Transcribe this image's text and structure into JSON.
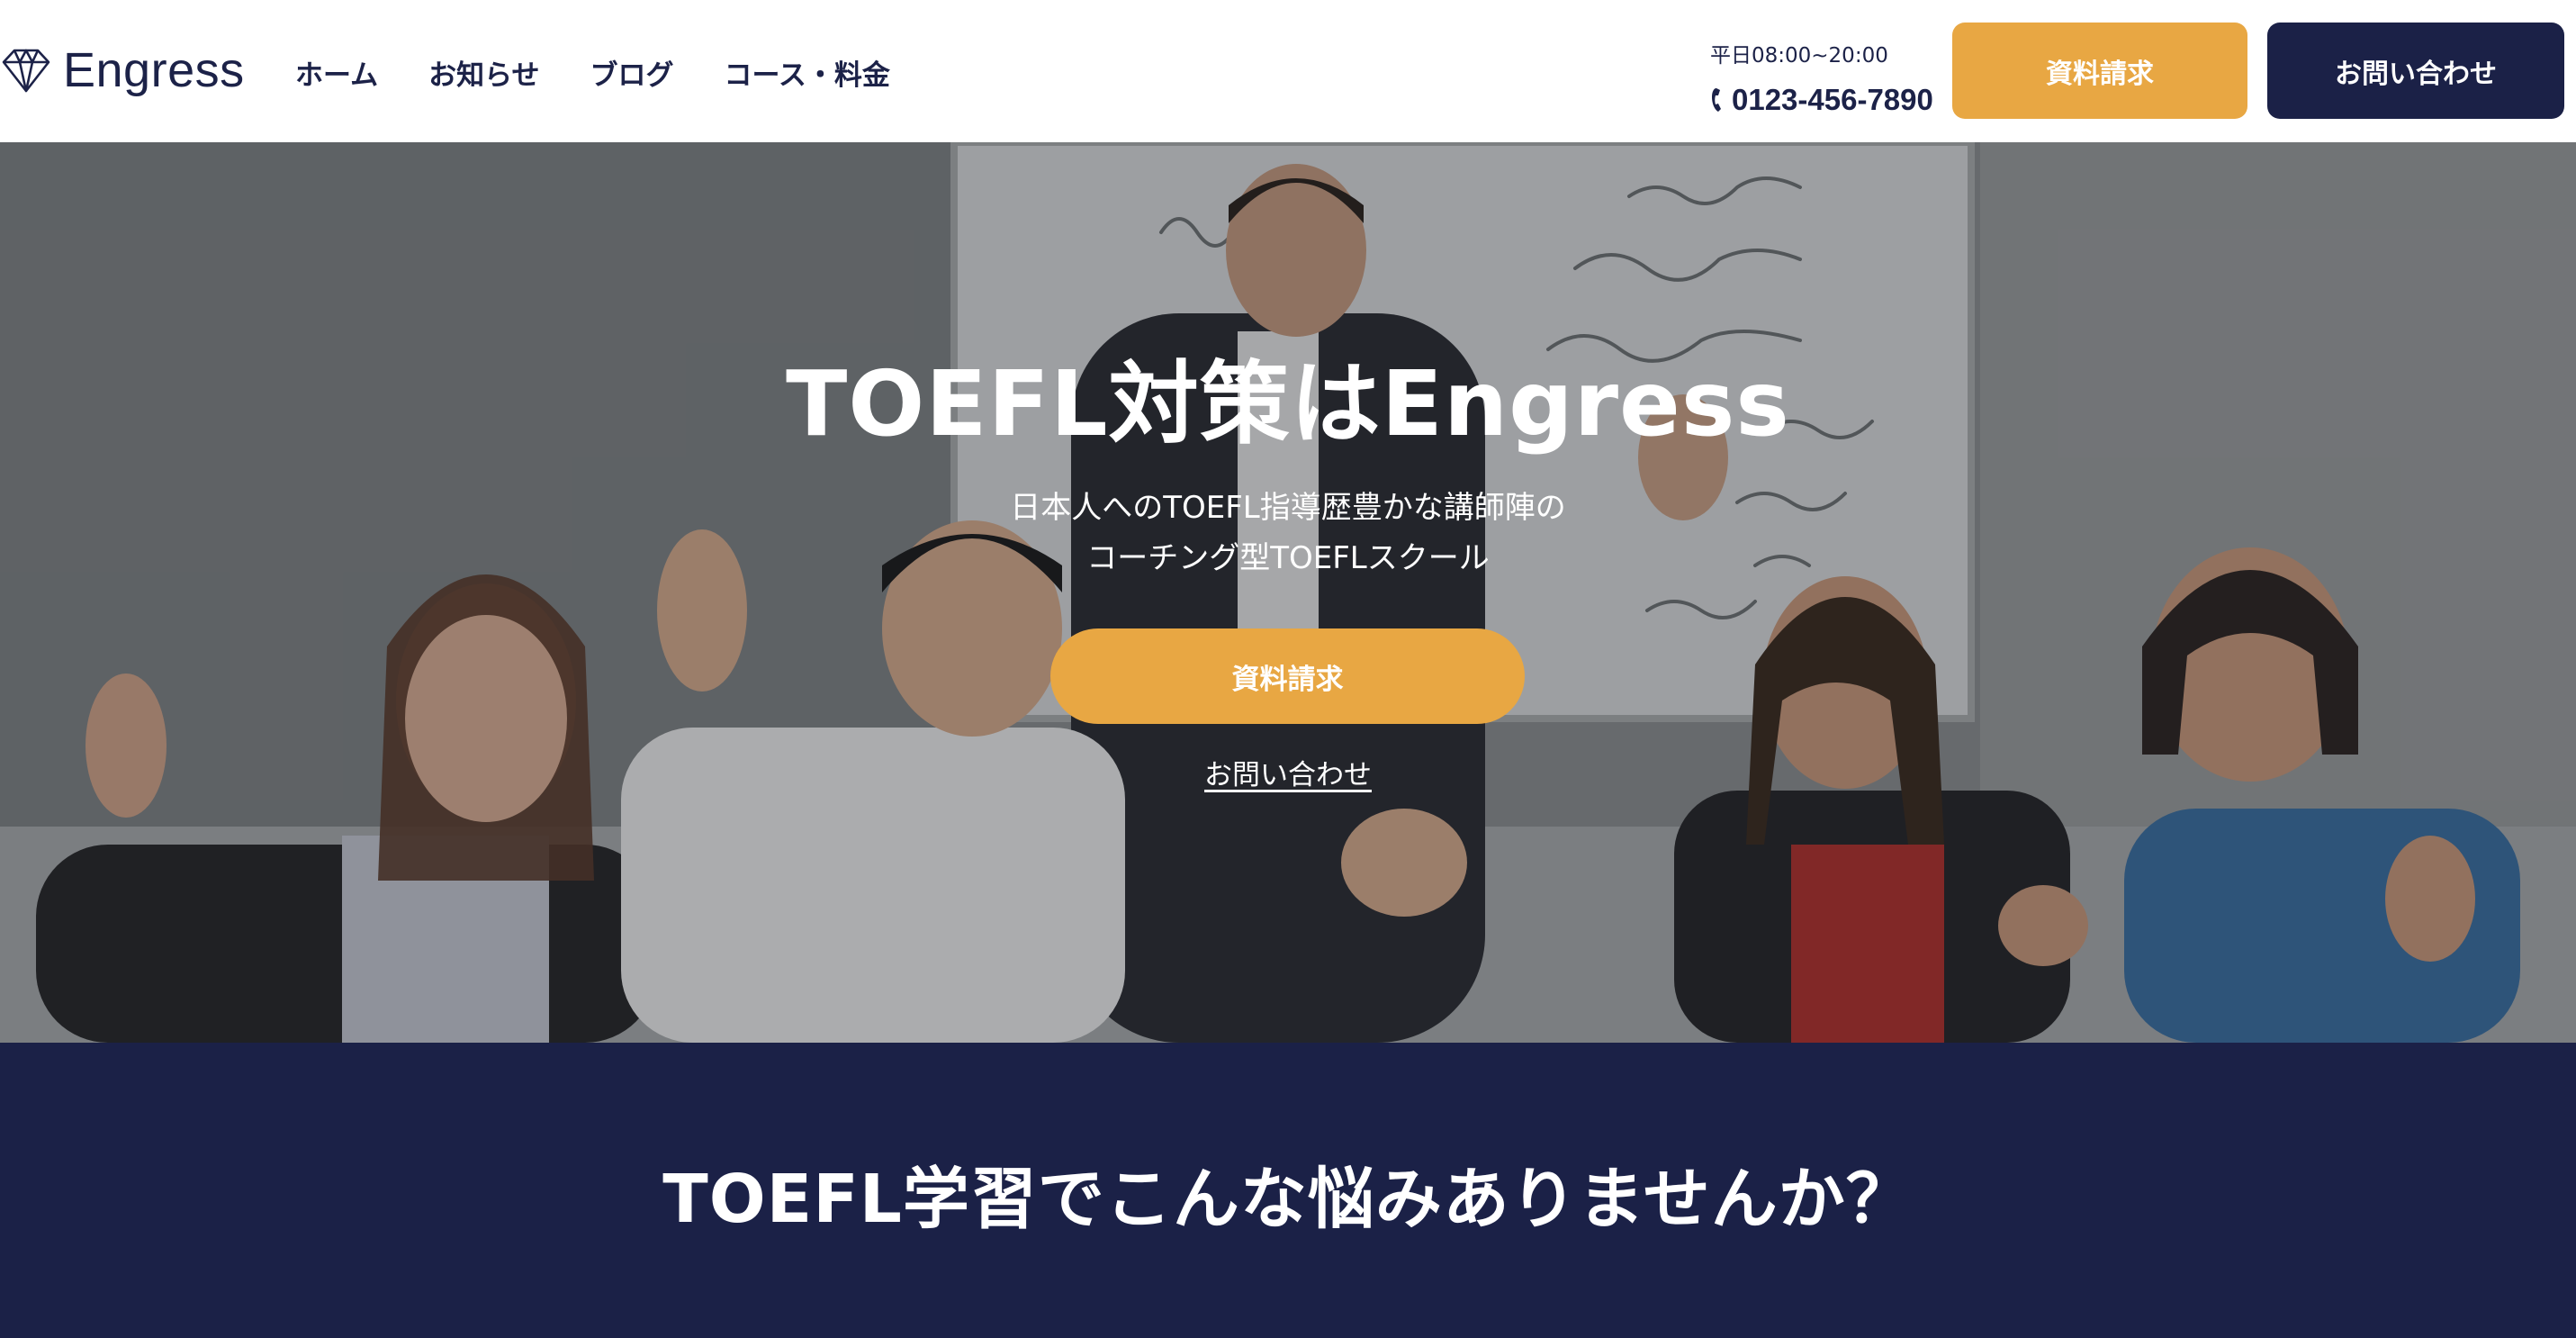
{
  "header": {
    "logo_text": "Engress",
    "nav": [
      {
        "label": "ホーム"
      },
      {
        "label": "お知らせ"
      },
      {
        "label": "ブログ"
      },
      {
        "label": "コース・料金"
      }
    ],
    "hours": "平日08:00~20:00",
    "phone": "0123-456-7890",
    "request_button": "資料請求",
    "contact_button": "お問い合わせ"
  },
  "hero": {
    "title": "TOEFL対策はEngress",
    "subtitle_lines": [
      "日本人へのTOEFL指導歴豊かな講師陣の",
      "コーチング型TOEFLスクール"
    ],
    "cta_button": "資料請求",
    "contact_link": "お問い合わせ"
  },
  "band": {
    "heading": "TOEFL学習でこんな悩みありませんか？"
  },
  "colors": {
    "navy": "#1b2147",
    "accent_orange": "#e8a743",
    "white": "#ffffff"
  },
  "icons": {
    "logo": "diamond-icon",
    "phone": "phone-icon"
  }
}
